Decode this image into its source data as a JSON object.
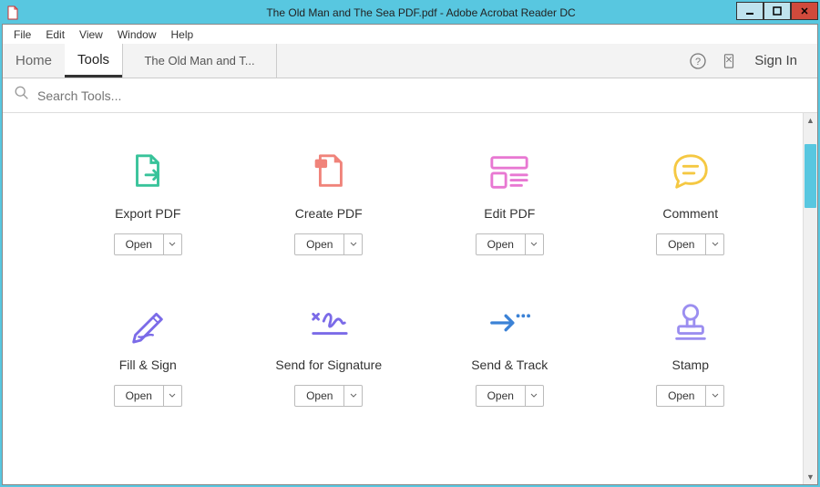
{
  "titlebar": {
    "title": "The Old Man and The Sea PDF.pdf - Adobe Acrobat Reader DC"
  },
  "menubar": {
    "file": "File",
    "edit": "Edit",
    "view": "View",
    "window": "Window",
    "help": "Help"
  },
  "tabs": {
    "home": "Home",
    "tools": "Tools",
    "document": "The Old Man and T..."
  },
  "topright": {
    "signin": "Sign In"
  },
  "search": {
    "placeholder": "Search Tools..."
  },
  "tools": [
    {
      "id": "export-pdf",
      "label": "Export PDF",
      "open": "Open",
      "icon": "export-pdf-icon"
    },
    {
      "id": "create-pdf",
      "label": "Create PDF",
      "open": "Open",
      "icon": "create-pdf-icon"
    },
    {
      "id": "edit-pdf",
      "label": "Edit PDF",
      "open": "Open",
      "icon": "edit-pdf-icon"
    },
    {
      "id": "comment",
      "label": "Comment",
      "open": "Open",
      "icon": "comment-icon"
    },
    {
      "id": "fill-sign",
      "label": "Fill & Sign",
      "open": "Open",
      "icon": "fill-sign-icon"
    },
    {
      "id": "send-signature",
      "label": "Send for Signature",
      "open": "Open",
      "icon": "send-signature-icon"
    },
    {
      "id": "send-track",
      "label": "Send & Track",
      "open": "Open",
      "icon": "send-track-icon"
    },
    {
      "id": "stamp",
      "label": "Stamp",
      "open": "Open",
      "icon": "stamp-icon"
    }
  ]
}
